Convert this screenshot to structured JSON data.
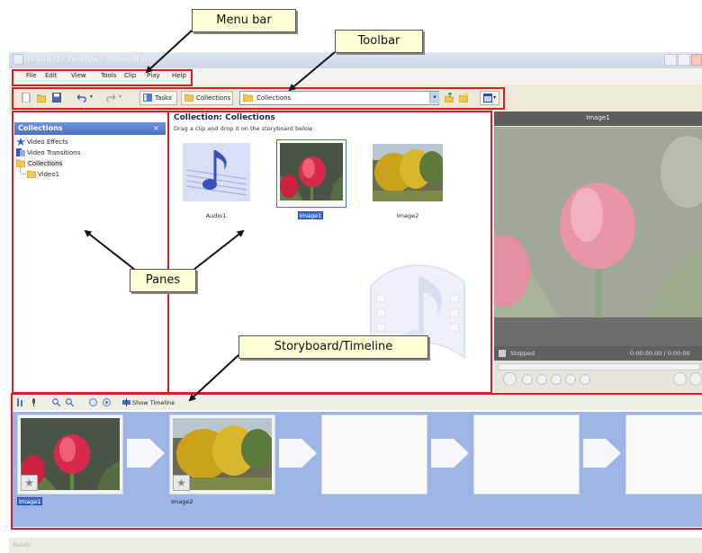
{
  "window": {
    "title": "Untitled - Windows Movie Maker"
  },
  "menu": {
    "items": [
      "File",
      "Edit",
      "View",
      "Tools",
      "Clip",
      "Play",
      "Help"
    ]
  },
  "toolbar": {
    "tasks_label": "Tasks",
    "collections_label": "Collections",
    "combo_value": "Collections"
  },
  "tasks_pane": {
    "title": "Collections",
    "close_glyph": "×",
    "items": [
      "Video Effects",
      "Video Transitions",
      "Collections",
      "Video1"
    ]
  },
  "collection": {
    "title": "Collection: Collections",
    "subtitle": "Drag a clip and drop it on the storyboard below",
    "items": [
      {
        "label": "Audio1",
        "selected": false
      },
      {
        "label": "Image1",
        "selected": true
      },
      {
        "label": "Image2",
        "selected": false
      }
    ]
  },
  "preview": {
    "title": "Image1",
    "status": "Stopped",
    "time": "0:00:00.00 / 0:00:00"
  },
  "storyboard": {
    "show_timeline": "Show Timeline",
    "clips": [
      {
        "label": "Image1",
        "selected": true
      },
      {
        "label": "Image2",
        "selected": false
      }
    ]
  },
  "status_bar": {
    "text": "Ready"
  },
  "callouts": {
    "menu_bar": "Menu bar",
    "toolbar": "Toolbar",
    "panes": "Panes",
    "storyboard": "Storyboard/Timeline"
  },
  "colors": {
    "highlight_box": "#d71f26",
    "callout_fill": "#ffffd6",
    "storyboard_strip": "#9db5e4",
    "task_header": "#4a72c2"
  }
}
